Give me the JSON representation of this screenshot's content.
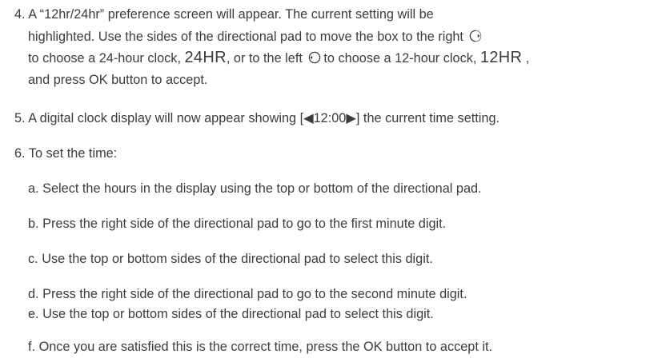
{
  "step4": {
    "line1": "4. A “12hr/24hr” preference screen will appear. The current setting will be",
    "line2": "highlighted. Use the sides of the directional pad to move the box to the right",
    "line3a": "to choose a 24-hour clock, ",
    "line3_24hr": "24HR",
    "line3b": ", or to the left ",
    "line3c": "to choose a 12-hour clock, ",
    "line3_12hr": "12HR",
    "line3d": " ,",
    "line4": "and press OK button to accept.",
    "icon_right": "directional-pad-right-icon",
    "icon_left": "directional-pad-left-icon"
  },
  "step5": {
    "text": "5. A digital clock display will now appear showing [◀12:00▶] the current time setting."
  },
  "step6": {
    "intro": "6. To set the time:",
    "a": "a. Select the hours in the display using the top or bottom of the directional pad.",
    "b": "b. Press the right side of the directional pad to go to the first minute digit.",
    "c": "c. Use the top or bottom sides of the directional pad to select this digit.",
    "d": "d. Press the right side of the directional pad to go to the second minute digit.",
    "e": "e. Use the top or bottom sides of the directional pad to select this digit.",
    "f": "f.  Once you are satisfied this is the correct time, press the OK button to accept it."
  },
  "colors": {
    "text": "#3c3c3c"
  }
}
